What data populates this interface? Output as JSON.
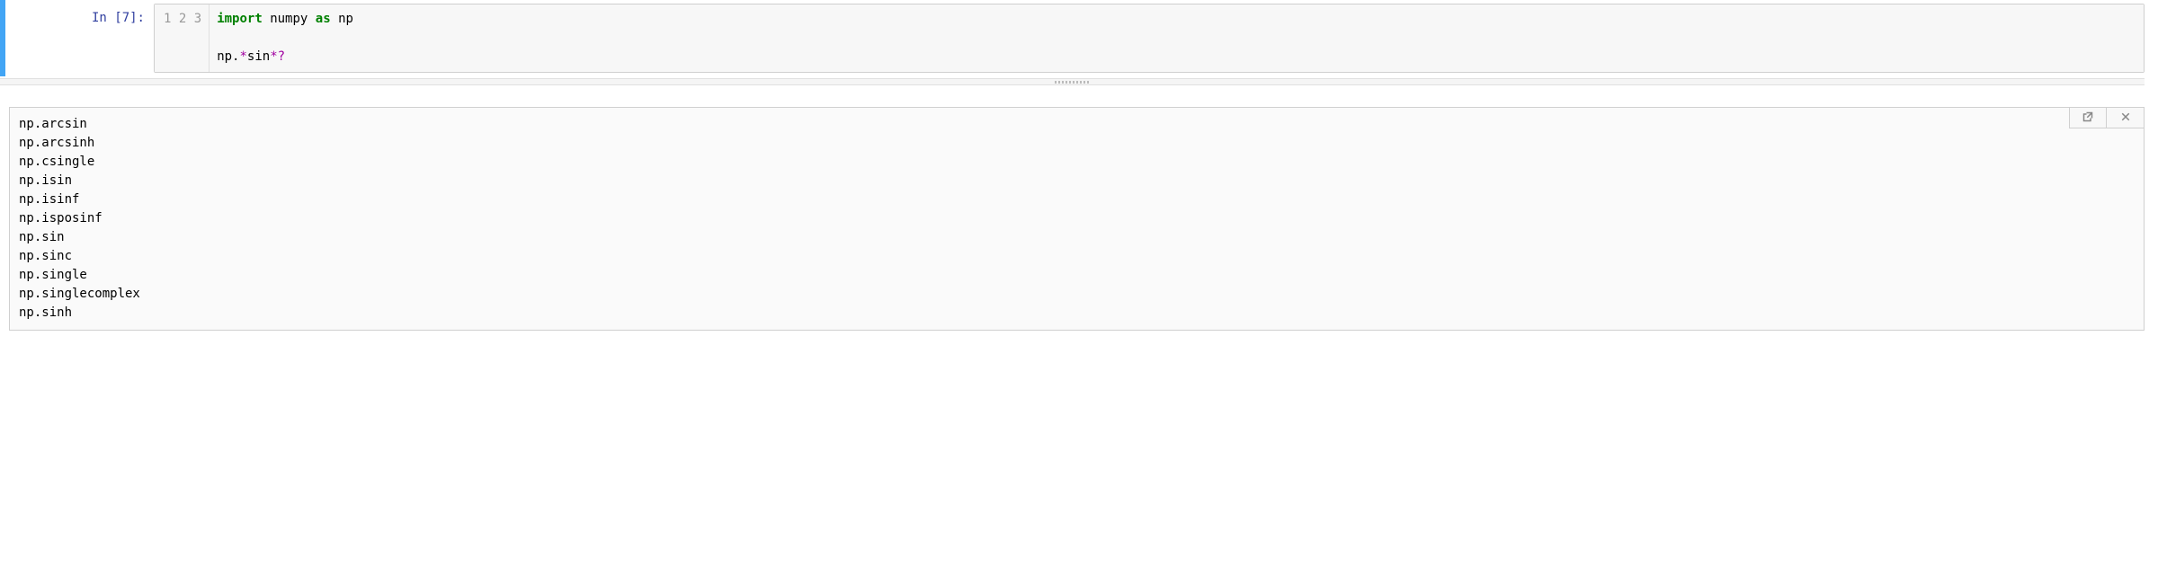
{
  "cell": {
    "prompt": "In [7]:",
    "gutter": [
      "1",
      "2",
      "3"
    ],
    "code": {
      "line1": {
        "kw1": "import",
        "sp1": " numpy ",
        "kw2": "as",
        "sp2": " np"
      },
      "line2": "",
      "line3": {
        "pre": "np.",
        "star1": "*",
        "mid": "sin",
        "star2": "*",
        "q": "?"
      }
    }
  },
  "output": {
    "lines": [
      "np.arcsin",
      "np.arcsinh",
      "np.csingle",
      "np.isin",
      "np.isinf",
      "np.isposinf",
      "np.sin",
      "np.sinc",
      "np.single",
      "np.singlecomplex",
      "np.sinh"
    ]
  }
}
